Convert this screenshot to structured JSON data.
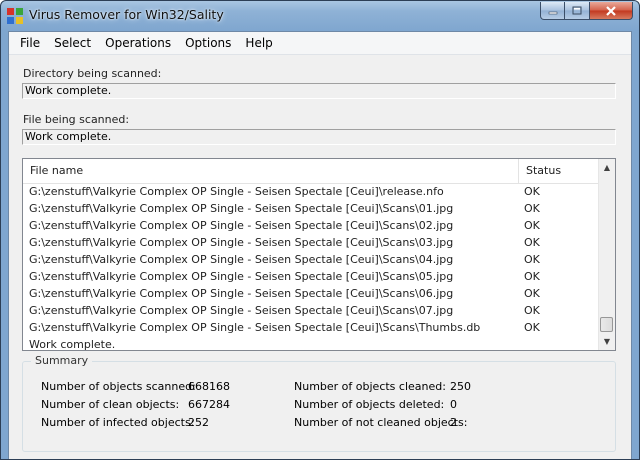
{
  "window": {
    "title": "Virus Remover for Win32/Sality"
  },
  "menu": [
    "File",
    "Select",
    "Operations",
    "Options",
    "Help"
  ],
  "directory": {
    "label": "Directory being scanned:",
    "value": "Work complete."
  },
  "file": {
    "label": "File being scanned:",
    "value": "Work complete."
  },
  "list": {
    "columns": {
      "name": "File name",
      "status": "Status"
    },
    "rows": [
      {
        "name": "G:\\zenstuff\\Valkyrie Complex OP Single - Seisen Spectale [Ceui]\\release.nfo",
        "status": "OK"
      },
      {
        "name": "G:\\zenstuff\\Valkyrie Complex OP Single - Seisen Spectale [Ceui]\\Scans\\01.jpg",
        "status": "OK"
      },
      {
        "name": "G:\\zenstuff\\Valkyrie Complex OP Single - Seisen Spectale [Ceui]\\Scans\\02.jpg",
        "status": "OK"
      },
      {
        "name": "G:\\zenstuff\\Valkyrie Complex OP Single - Seisen Spectale [Ceui]\\Scans\\03.jpg",
        "status": "OK"
      },
      {
        "name": "G:\\zenstuff\\Valkyrie Complex OP Single - Seisen Spectale [Ceui]\\Scans\\04.jpg",
        "status": "OK"
      },
      {
        "name": "G:\\zenstuff\\Valkyrie Complex OP Single - Seisen Spectale [Ceui]\\Scans\\05.jpg",
        "status": "OK"
      },
      {
        "name": "G:\\zenstuff\\Valkyrie Complex OP Single - Seisen Spectale [Ceui]\\Scans\\06.jpg",
        "status": "OK"
      },
      {
        "name": "G:\\zenstuff\\Valkyrie Complex OP Single - Seisen Spectale [Ceui]\\Scans\\07.jpg",
        "status": "OK"
      },
      {
        "name": "G:\\zenstuff\\Valkyrie Complex OP Single - Seisen Spectale [Ceui]\\Scans\\Thumbs.db",
        "status": "OK"
      },
      {
        "name": "Work complete.",
        "status": ""
      }
    ]
  },
  "summary": {
    "title": "Summary",
    "scanned": {
      "label": "Number of objects scanned:",
      "value": "668168"
    },
    "clean": {
      "label": "Number of clean objects:",
      "value": "667284"
    },
    "infected": {
      "label": "Number of infected objects:",
      "value": "252"
    },
    "cleaned": {
      "label": "Number of objects cleaned:",
      "value": "250"
    },
    "deleted": {
      "label": "Number of objects deleted:",
      "value": "0"
    },
    "not_cleaned": {
      "label": "Number of not cleaned objects:",
      "value": "2"
    }
  },
  "icons": {
    "app": "shield-app-icon",
    "minimize": "minimize-icon",
    "maximize": "maximize-icon",
    "close": "close-icon",
    "scroll_up": "scroll-up-arrow-icon",
    "scroll_down": "scroll-down-arrow-icon"
  }
}
